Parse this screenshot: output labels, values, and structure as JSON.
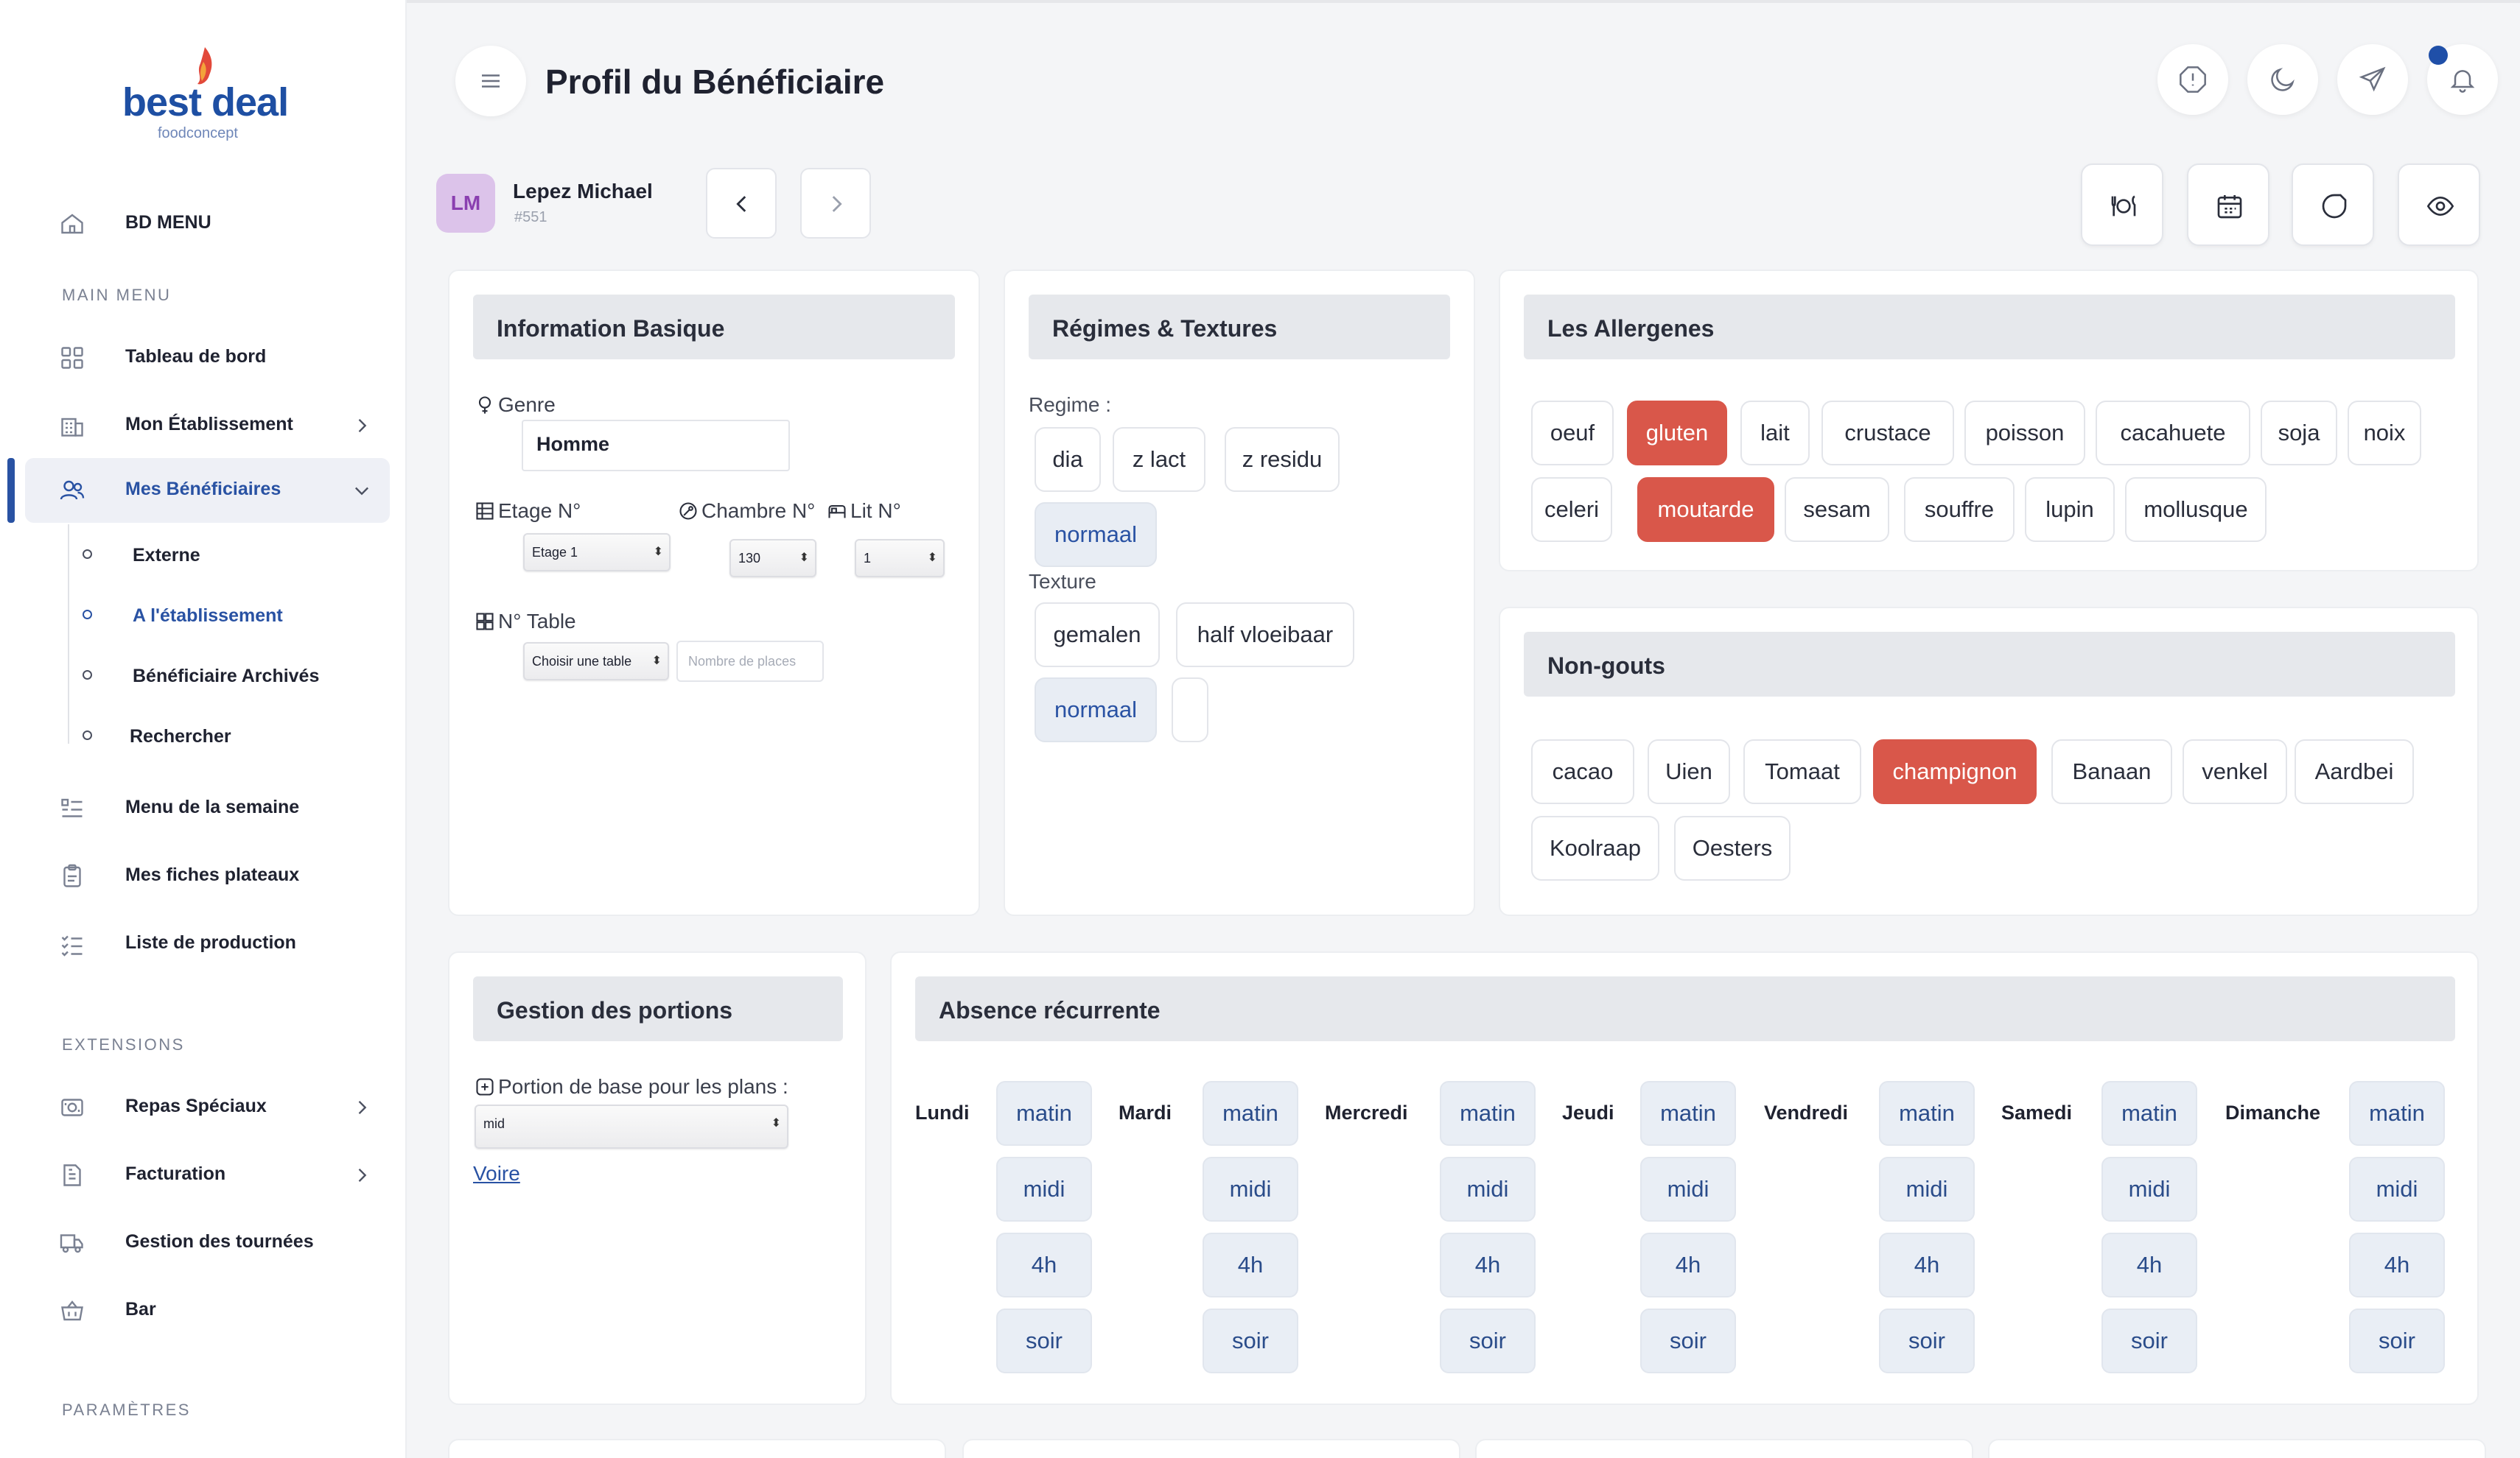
{
  "brand": {
    "name": "best deal",
    "sub": "foodconcept"
  },
  "sidebar": {
    "top_item": "BD MENU",
    "main_menu_heading": "MAIN MENU",
    "items": [
      {
        "label": "Tableau de bord"
      },
      {
        "label": "Mon Établissement"
      },
      {
        "label": "Mes Bénéficiaires"
      },
      {
        "label": "Menu de la semaine"
      },
      {
        "label": "Mes fiches plateaux"
      },
      {
        "label": "Liste de production"
      }
    ],
    "sub_items": [
      {
        "label": "Externe"
      },
      {
        "label": "A l'établissement"
      },
      {
        "label": "Bénéficiaire Archivés"
      },
      {
        "label": "Rechercher"
      }
    ],
    "extensions_heading": "EXTENSIONS",
    "extensions": [
      {
        "label": "Repas Spéciaux"
      },
      {
        "label": "Facturation"
      },
      {
        "label": "Gestion des tournées"
      },
      {
        "label": "Bar"
      }
    ],
    "params_heading": "PARAMÈTRES"
  },
  "header": {
    "title": "Profil du Bénéficiaire"
  },
  "patient": {
    "initials": "LM",
    "name": "Lepez Michael",
    "id": "#551"
  },
  "info": {
    "title": "Information Basique",
    "genre_label": "Genre",
    "genre_value": "Homme",
    "etage_label": "Etage N°",
    "etage_value": "Etage 1",
    "chambre_label": "Chambre N°",
    "chambre_value": "130",
    "lit_label": "Lit N°",
    "lit_value": "1",
    "table_label": "N° Table",
    "table_value": "Choisir une table",
    "places_placeholder": "Nombre de places"
  },
  "regimes": {
    "title": "Régimes & Textures",
    "regime_label": "Regime :",
    "regime_chips": [
      "dia",
      "z lact",
      "z residu",
      "normaal"
    ],
    "texture_label": "Texture",
    "texture_chips": [
      "gemalen",
      "half vloeibaar",
      "normaal",
      ""
    ]
  },
  "allergens": {
    "title": "Les Allergenes",
    "chips": [
      "oeuf",
      "gluten",
      "lait",
      "crustace",
      "poisson",
      "cacahuete",
      "soja",
      "noix",
      "celeri",
      "moutarde",
      "sesam",
      "souffre",
      "lupin",
      "mollusque"
    ],
    "selected": [
      "gluten",
      "moutarde"
    ]
  },
  "dislikes": {
    "title": "Non-gouts",
    "chips": [
      "cacao",
      "Uien",
      "Tomaat",
      "champignon",
      "Banaan",
      "venkel",
      "Aardbei",
      "Koolraap",
      "Oesters"
    ],
    "selected": [
      "champignon"
    ]
  },
  "portions": {
    "title": "Gestion des portions",
    "base_label": "Portion de base pour les plans :",
    "base_value": "mid",
    "link": "Voire"
  },
  "absence": {
    "title": "Absence récurrente",
    "days": [
      "Lundi",
      "Mardi",
      "Mercredi",
      "Jeudi",
      "Vendredi",
      "Samedi",
      "Dimanche"
    ],
    "slots": [
      "matin",
      "midi",
      "4h",
      "soir"
    ]
  },
  "colors": {
    "accent": "#2952a3",
    "selected": "#d9574a",
    "avatar_bg": "#dcc3ea"
  }
}
